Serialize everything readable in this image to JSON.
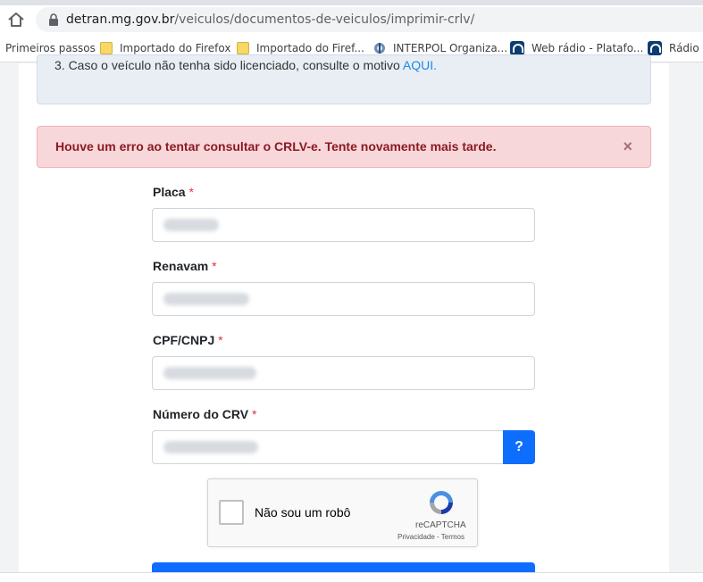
{
  "browser": {
    "url_host": "detran.mg.gov.br",
    "url_path": "/veiculos/documentos-de-veiculos/imprimir-crlv/",
    "bookmarks": [
      {
        "label": "Primeiros passos",
        "icon": "none"
      },
      {
        "label": "Importado do Firefox",
        "icon": "folder-icon"
      },
      {
        "label": "Importado do Firef...",
        "icon": "folder-icon"
      },
      {
        "label": "INTERPOL Organiza...",
        "icon": "interpol-icon"
      },
      {
        "label": "Web rádio - Platafo...",
        "icon": "headset-icon"
      },
      {
        "label": "Rádio L",
        "icon": "headset-icon"
      }
    ]
  },
  "info": {
    "text": "3. Caso o veículo não tenha sido licenciado, consulte o motivo",
    "link": "AQUI."
  },
  "alert": {
    "message": "Houve um erro ao tentar consultar o CRLV-e. Tente novamente mais tarde.",
    "close": "×"
  },
  "form": {
    "placa_label": "Placa",
    "renavam_label": "Renavam",
    "cpf_label": "CPF/CNPJ",
    "crv_label": "Número do CRV",
    "required_mark": "*",
    "help_label": "?"
  },
  "recaptcha": {
    "label": "Não sou um robô",
    "brand": "reCAPTCHA",
    "links": "Privacidade - Termos"
  },
  "colors": {
    "accent": "#0d6efd",
    "alert_bg": "#f8d7da",
    "alert_text": "#8b1a24",
    "info_bg": "#e9eef5"
  }
}
